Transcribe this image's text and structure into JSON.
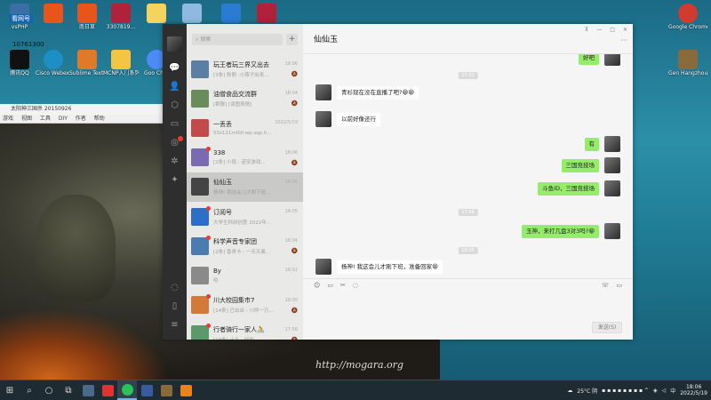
{
  "desktop": {
    "icons": [
      {
        "label": "vsPHP",
        "color": "#3a6ea5"
      },
      {
        "label": "",
        "color": "#e8541a"
      },
      {
        "label": "南日草",
        "color": "#e8541a"
      },
      {
        "label": "3307819...",
        "color": "#b0213b"
      },
      {
        "label": "",
        "color": "#f4d35e"
      },
      {
        "label": "",
        "color": "#8fb9e0"
      },
      {
        "label": "",
        "color": "#2a7bd3"
      },
      {
        "label": "",
        "color": "#b0213b"
      },
      {
        "label": "腾讯QQ",
        "color": "#111111"
      },
      {
        "label": "Cisco Webex...",
        "color": "#1e8fc4"
      },
      {
        "label": "Sublime Text 3",
        "color": "#e07a2a"
      },
      {
        "label": "MCNP入门系列",
        "color": "#f4c542"
      },
      {
        "label": "Goo Chro",
        "color": "#4c8bf5"
      }
    ],
    "overlay_text": "看网号",
    "overlay_number": "10761300",
    "right_icons": [
      {
        "label": "Google Chrome",
        "color": "#d33a2f"
      },
      {
        "label": "Gen Hangzhou 2022",
        "color": "#8a6a3a"
      }
    ],
    "watermark": "http://mogara.org"
  },
  "game_window": {
    "title": "太阳神三国杀 20150926",
    "menu": [
      "游戏",
      "视图",
      "工具",
      "DIY",
      "作者",
      "帮助"
    ]
  },
  "wechat": {
    "search_placeholder": "搜索",
    "add_label": "+",
    "chats": [
      {
        "name": "玩王者玩三界又出去",
        "sub": "[3条] 陈刚 :小燕子出来...",
        "time": "18:06",
        "color": "#5b7fa3",
        "badge": false,
        "muted": true
      },
      {
        "name": "油僧食品交流群",
        "sub": "[群聊] [读图表情]",
        "time": "18:04",
        "color": "#6a8c5a",
        "badge": false,
        "muted": true
      },
      {
        "name": "一丢丢",
        "sub": "50z121m0iif.wp.sqp.h...",
        "time": "2022/5/19",
        "color": "#c44a4a",
        "badge": false,
        "muted": false
      },
      {
        "name": "338",
        "sub": "[2条] 小雨 : 诺安游戏...",
        "time": "18:06",
        "color": "#7a6ab0",
        "badge": true,
        "muted": true
      },
      {
        "name": "仙仙玉",
        "sub": "杨神! 我这会儿才刚下班...",
        "time": "18:05",
        "color": "#444444",
        "badge": false,
        "muted": false,
        "active": true
      },
      {
        "name": "订阅号",
        "sub": "大学生科研创意 2022年...",
        "time": "18:05",
        "color": "#2b6fc9",
        "badge": true,
        "muted": false
      },
      {
        "name": "科学声音专家团",
        "sub": "[2条] 香青卡 : 一天天离...",
        "time": "18:04",
        "color": "#4a7cb0",
        "badge": true,
        "muted": true
      },
      {
        "name": "By",
        "sub": "哈",
        "time": "18:02",
        "color": "#8a8a8a",
        "badge": false,
        "muted": false
      },
      {
        "name": "川大校园集市7",
        "sub": "[14条] 已出台 - 川师一万...",
        "time": "18:00",
        "color": "#d17a3a",
        "badge": true,
        "muted": true
      },
      {
        "name": "行者骑行一家人🚴",
        "sub": "[18条] 十九 : 好的...",
        "time": "17:56",
        "color": "#5a9a6a",
        "badge": true,
        "muted": true
      }
    ],
    "conversation": {
      "title": "仙仙玉",
      "window_controls": [
        "⊼",
        "—",
        "□",
        "✕"
      ],
      "more": "···",
      "messages": [
        {
          "side": "right",
          "text": "好吧"
        },
        {
          "type": "time",
          "text": "17:32"
        },
        {
          "side": "left",
          "text": "青衫现在没在直播了吧?😁😁"
        },
        {
          "side": "left",
          "text": "以前好像还行"
        },
        {
          "side": "right",
          "text": "有"
        },
        {
          "side": "right",
          "text": "三国竞技场"
        },
        {
          "side": "right",
          "text": "斗鱼ID，三国竞技场"
        },
        {
          "type": "time",
          "text": "17:58"
        },
        {
          "side": "right",
          "text": "玉神，来打几盘3对3吗?😁"
        },
        {
          "type": "time",
          "text": "18:05"
        },
        {
          "side": "left",
          "text": "杨神! 我这会儿才刚下班，准备回家😁"
        }
      ],
      "send_label": "发送(S)"
    }
  },
  "taskbar": {
    "weather": "25°C 阴",
    "time": "18:06",
    "date": "2022/5/19"
  }
}
